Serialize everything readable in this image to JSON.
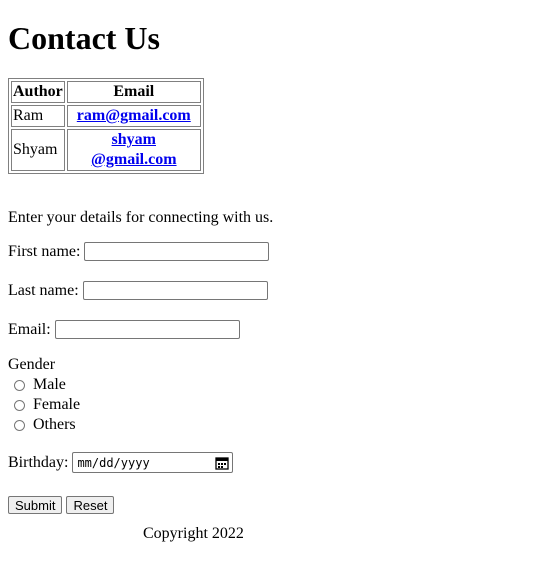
{
  "page": {
    "title": "Contact Us"
  },
  "contacts": {
    "headers": {
      "author": "Author",
      "email": "Email"
    },
    "rows": [
      {
        "author": "Ram",
        "email": "ram@gmail.com"
      },
      {
        "author": "Shyam",
        "email": "shyam @gmail.com"
      }
    ]
  },
  "form": {
    "intro": "Enter your details for connecting with us.",
    "first_name_label": "First name:",
    "last_name_label": "Last name:",
    "email_label": "Email:",
    "gender_label": "Gender",
    "gender_options": [
      "Male",
      "Female",
      "Others"
    ],
    "birthday_label": "Birthday:",
    "birthday_placeholder": "mm/dd/yyyy",
    "submit_label": "Submit",
    "reset_label": "Reset"
  },
  "footer": {
    "copyright": "Copyright 2022"
  },
  "colors": {
    "link": "#0000ee",
    "border": "#767676",
    "button_bg": "#efefef"
  },
  "icons": {
    "date_picker": "calendar-icon"
  }
}
